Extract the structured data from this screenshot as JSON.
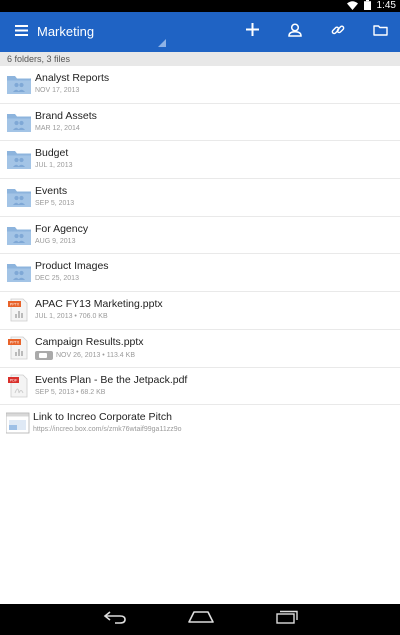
{
  "status_bar": {
    "time": "1:45"
  },
  "app_bar": {
    "title": "Marketing",
    "actions": [
      "add-icon",
      "user-icon",
      "link-icon",
      "folder-icon"
    ]
  },
  "summary": "6 folders, 3 files",
  "items": [
    {
      "type": "folder",
      "icon": "folder-icon",
      "name": "Analyst Reports",
      "meta": "NOV 17, 2013"
    },
    {
      "type": "folder",
      "icon": "folder-icon",
      "name": "Brand Assets",
      "meta": "MAR 12, 2014"
    },
    {
      "type": "folder",
      "icon": "folder-icon",
      "name": "Budget",
      "meta": "JUL 1, 2013"
    },
    {
      "type": "folder",
      "icon": "folder-icon",
      "name": "Events",
      "meta": "SEP 5, 2013"
    },
    {
      "type": "folder",
      "icon": "folder-icon",
      "name": "For Agency",
      "meta": "AUG 9, 2013"
    },
    {
      "type": "folder",
      "icon": "folder-icon",
      "name": "Product Images",
      "meta": "DEC 25, 2013"
    },
    {
      "type": "file",
      "icon": "pptx-file-icon",
      "name": "APAC FY13 Marketing.pptx",
      "meta": "JUL 1, 2013 • 706.0 KB"
    },
    {
      "type": "file",
      "icon": "pptx-file-icon",
      "name": "Campaign Results.pptx",
      "meta": "NOV 26, 2013 • 113.4 KB",
      "has_comments": true
    },
    {
      "type": "file",
      "icon": "pdf-file-icon",
      "name": "Events Plan - Be the Jetpack.pdf",
      "meta": "SEP 5, 2013 • 68.2 KB"
    }
  ],
  "link_item": {
    "icon": "weblink-icon",
    "name": "Link to Increo Corporate Pitch",
    "url": "https://increo.box.com/s/zmk76wtaif99ga11zz9o"
  },
  "nav_bar": [
    "back-icon",
    "home-icon",
    "recent-apps-icon"
  ],
  "colors": {
    "app_bar": "#1f63c4",
    "folder": "#8db4dd",
    "pptx": "#e8632a",
    "pdf": "#d9302b"
  }
}
